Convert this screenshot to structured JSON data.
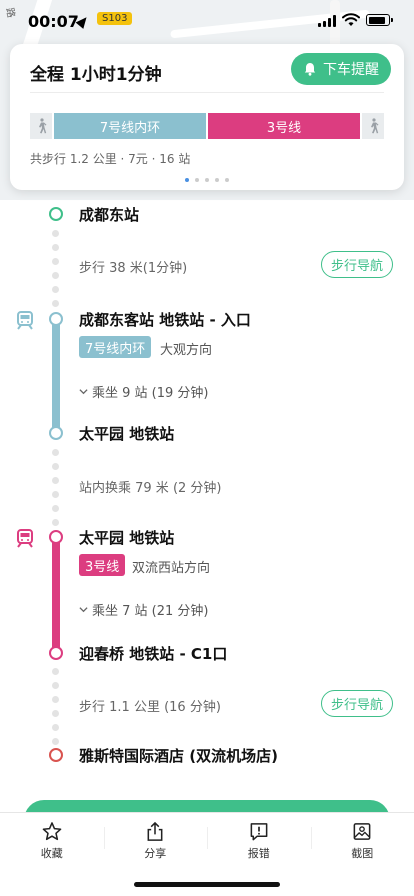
{
  "status_bar": {
    "time": "00:07",
    "road_badge": "S103"
  },
  "map": {
    "road_label": "路"
  },
  "summary": {
    "title": "全程 1小时1分钟",
    "remind_button": "下车提醒",
    "segments": [
      {
        "type": "walk"
      },
      {
        "type": "line",
        "label": "7号线内环",
        "color": "#8bc0cf"
      },
      {
        "type": "line",
        "label": "3号线",
        "color": "#dc3d80"
      },
      {
        "type": "walk"
      }
    ],
    "meta": "共步行 1.2 公里 · 7元 · 16 站",
    "page_dots": 5,
    "active_dot": 0
  },
  "route": {
    "start": {
      "name": "成都东站",
      "color": "#3fbf8a"
    },
    "walk1": {
      "text": "步行 38 米(1分钟)",
      "nav_label": "步行导航"
    },
    "leg1": {
      "board_stop": "成都东客站 地铁站 - 入口",
      "line_label": "7号线内环",
      "line_color": "#8bc0cf",
      "direction": "大观方向",
      "ride_info": "乘坐 9 站 (19 分钟)",
      "alight_stop": "太平园 地铁站"
    },
    "transfer": {
      "text": "站内换乘 79 米 (2 分钟)"
    },
    "leg2": {
      "board_stop": "太平园 地铁站",
      "line_label": "3号线",
      "line_color": "#dc3d80",
      "direction": "双流西站方向",
      "ride_info": "乘坐 7 站 (21 分钟)",
      "alight_stop": "迎春桥 地铁站 - C1口"
    },
    "walk2": {
      "text": "步行 1.1 公里 (16 分钟)",
      "nav_label": "步行导航"
    },
    "end": {
      "name": "雅斯特国际酒店 (双流机场店)",
      "color": "#d9534f"
    }
  },
  "tabbar": {
    "items": [
      {
        "label": "收藏",
        "icon": "star-icon"
      },
      {
        "label": "分享",
        "icon": "share-icon"
      },
      {
        "label": "报错",
        "icon": "report-icon"
      },
      {
        "label": "截图",
        "icon": "screenshot-icon"
      }
    ]
  },
  "colors": {
    "accent_green": "#3fbf8a",
    "line7": "#8bc0cf",
    "line3": "#dc3d80"
  }
}
